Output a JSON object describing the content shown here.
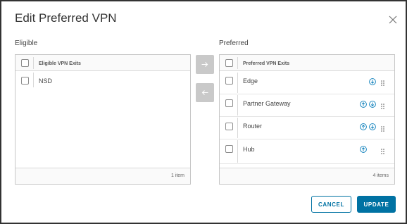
{
  "dialog": {
    "title": "Edit Preferred VPN",
    "accent_color": "#0072a3"
  },
  "eligible": {
    "section_label": "Eligible",
    "column_header": "Eligible VPN Exits",
    "rows": [
      {
        "label": "NSD"
      }
    ],
    "footer_count": "1 item"
  },
  "preferred": {
    "section_label": "Preferred",
    "column_header": "Preferred VPN Exits",
    "rows": [
      {
        "label": "Edge",
        "icons": [
          "arrow-down-icon"
        ]
      },
      {
        "label": "Partner Gateway",
        "icons": [
          "arrow-up-icon",
          "arrow-down-icon"
        ]
      },
      {
        "label": "Router",
        "icons": [
          "arrow-up-icon",
          "arrow-down-icon"
        ]
      },
      {
        "label": "Hub",
        "icons": [
          "arrow-up-icon"
        ]
      }
    ],
    "footer_count": "4 items"
  },
  "transfer": {
    "move_right_icon": "arrow-right-icon",
    "move_left_icon": "arrow-left-icon"
  },
  "actions": {
    "cancel_label": "CANCEL",
    "update_label": "UPDATE"
  }
}
